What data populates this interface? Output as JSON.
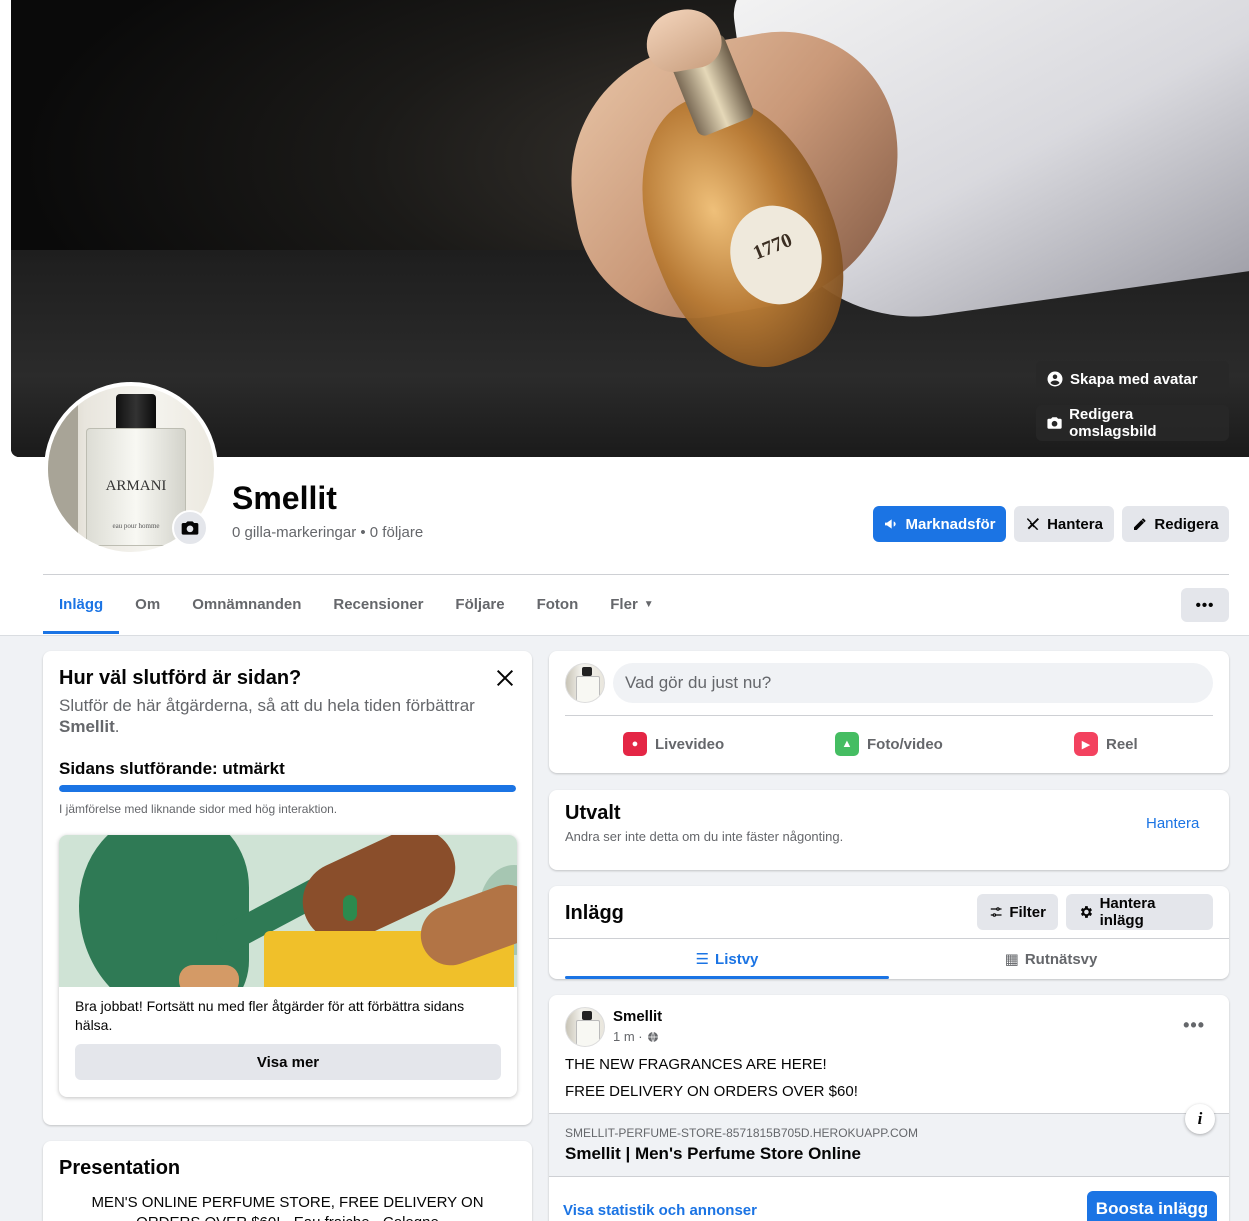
{
  "cover": {
    "bottle_label": "1770",
    "avatar_button": "Skapa med avatar",
    "edit_cover_button": "Redigera omslagsbild"
  },
  "profile": {
    "avatar_brand": "ARMANI",
    "avatar_sub": "eau pour homme",
    "name": "Smellit",
    "stats": "0 gilla-markeringar • 0 följare"
  },
  "actions": {
    "promote": "Marknadsför",
    "manage": "Hantera",
    "edit": "Redigera"
  },
  "tabs": [
    {
      "label": "Inlägg",
      "active": true
    },
    {
      "label": "Om"
    },
    {
      "label": "Omnämnanden"
    },
    {
      "label": "Recensioner"
    },
    {
      "label": "Följare"
    },
    {
      "label": "Foton"
    },
    {
      "label": "Fler"
    }
  ],
  "more_button": "•••",
  "completion": {
    "title": "Hur väl slutförd är sidan?",
    "desc_prefix": "Slutför de här åtgärderna, så att du hela tiden förbättrar",
    "desc_page": "Smellit",
    "desc_suffix": ".",
    "status": "Sidans slutförande: utmärkt",
    "progress": 1.0,
    "comparison": "I jämförelse med liknande sidor med hög interaktion.",
    "tip": "Bra jobbat! Fortsätt nu med fler åtgärder för att förbättra sidans hälsa.",
    "see_more": "Visa mer"
  },
  "presentation": {
    "title": "Presentation",
    "text": "MEN'S ONLINE PERFUME STORE, FREE DELIVERY ON ORDERS OVER $60! - Eau fraiche - Cologne"
  },
  "composer": {
    "placeholder": "Vad gör du just nu?",
    "live": "Livevideo",
    "photo": "Foto/video",
    "reel": "Reel"
  },
  "featured": {
    "title": "Utvalt",
    "subtitle": "Andra ser inte detta om du inte fäster någonting.",
    "manage": "Hantera"
  },
  "posts": {
    "title": "Inlägg",
    "filter": "Filter",
    "manage_posts": "Hantera inlägg",
    "list_view": "Listvy",
    "grid_view": "Rutnätsvy"
  },
  "post": {
    "author": "Smellit",
    "time": "1 m ·",
    "line1": "THE NEW FRAGRANCES ARE HERE!",
    "line2": "FREE DELIVERY ON ORDERS OVER $60!",
    "link_domain": "SMELLIT-PERFUME-STORE-8571815B705D.HEROKUAPP.COM",
    "link_title": "Smellit | Men's Perfume Store Online",
    "stats_link": "Visa statistik och annonser",
    "boost": "Boosta inlägg"
  },
  "colors": {
    "accent": "#1b74e4",
    "background": "#f0f2f5"
  }
}
